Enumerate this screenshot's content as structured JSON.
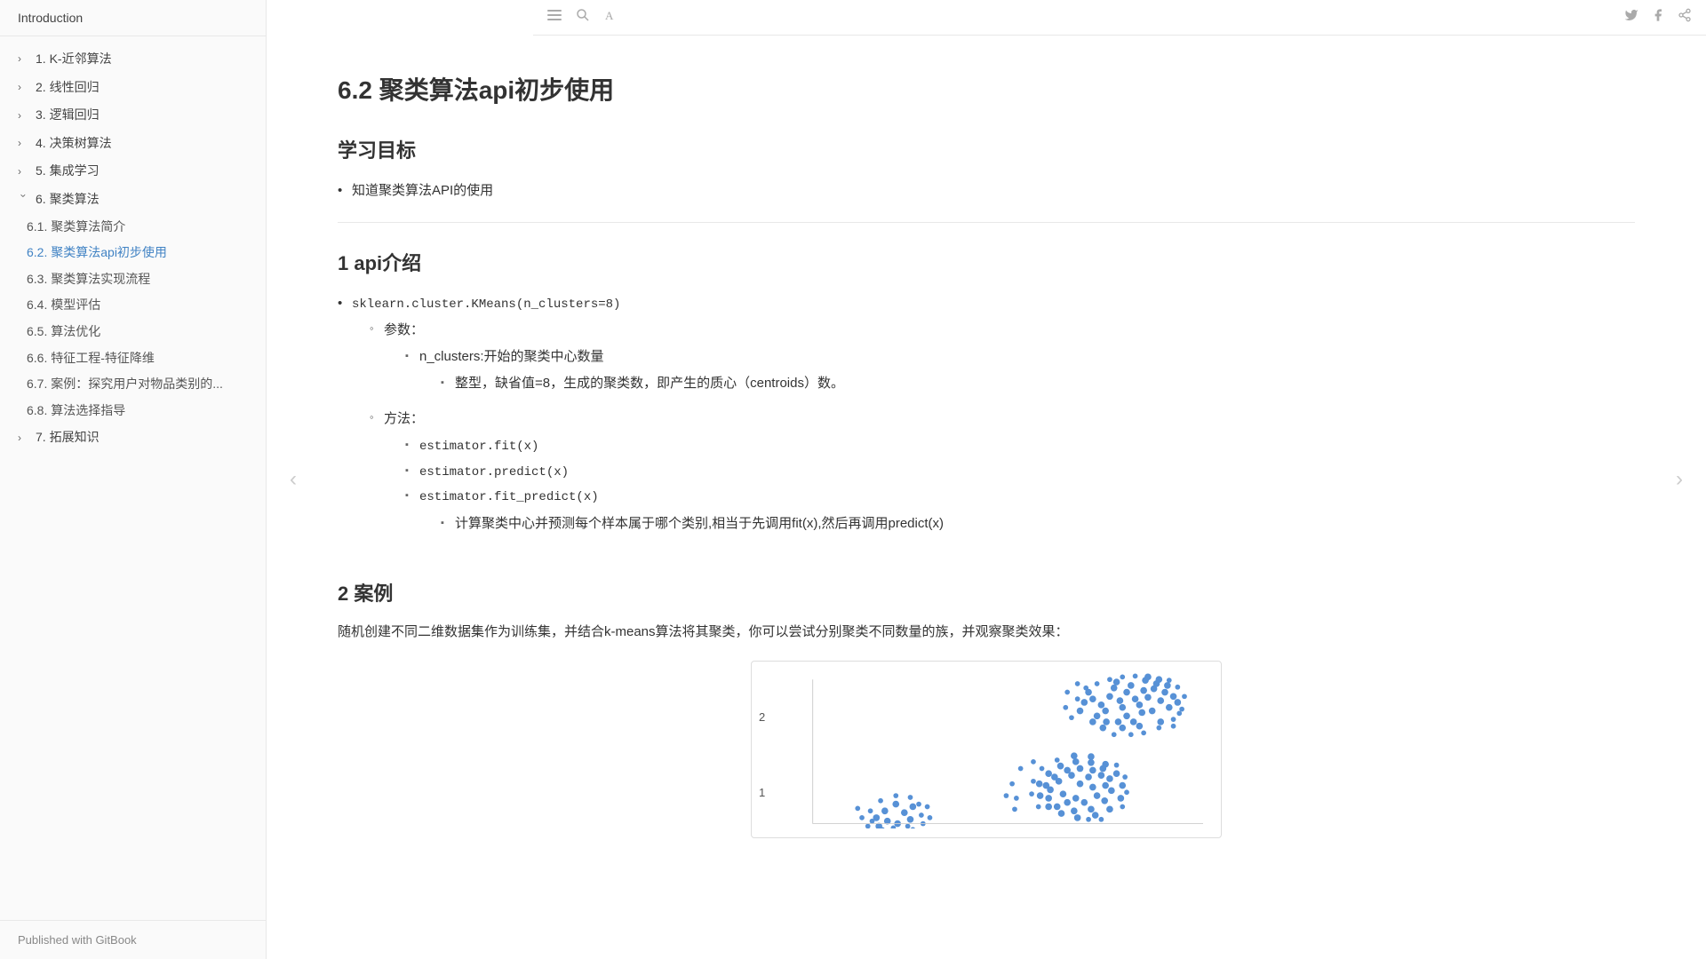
{
  "sidebar": {
    "introduction": "Introduction",
    "items": [
      {
        "id": "knn",
        "label": "1. K-近邻算法",
        "expanded": false,
        "indent": 0
      },
      {
        "id": "linear",
        "label": "2. 线性回归",
        "expanded": false,
        "indent": 0
      },
      {
        "id": "logic",
        "label": "3. 逻辑回归",
        "expanded": false,
        "indent": 0
      },
      {
        "id": "tree",
        "label": "4. 决策树算法",
        "expanded": false,
        "indent": 0
      },
      {
        "id": "ensemble",
        "label": "5. 集成学习",
        "expanded": false,
        "indent": 0
      },
      {
        "id": "clustering",
        "label": "6. 聚类算法",
        "expanded": true,
        "indent": 0
      },
      {
        "id": "c6-1",
        "label": "6.1. 聚类算法简介",
        "expanded": false,
        "indent": 1,
        "sub": true
      },
      {
        "id": "c6-2",
        "label": "6.2. 聚类算法api初步使用",
        "expanded": false,
        "indent": 1,
        "sub": true,
        "active": true
      },
      {
        "id": "c6-3",
        "label": "6.3. 聚类算法实现流程",
        "expanded": false,
        "indent": 1,
        "sub": true
      },
      {
        "id": "c6-4",
        "label": "6.4. 模型评估",
        "expanded": false,
        "indent": 1,
        "sub": true
      },
      {
        "id": "c6-5",
        "label": "6.5. 算法优化",
        "expanded": false,
        "indent": 1,
        "sub": true
      },
      {
        "id": "c6-6",
        "label": "6.6. 特征工程-特征降维",
        "expanded": false,
        "indent": 1,
        "sub": true
      },
      {
        "id": "c6-7",
        "label": "6.7. 案例：探究用户对物品类别的...",
        "expanded": false,
        "indent": 1,
        "sub": true
      },
      {
        "id": "c6-8",
        "label": "6.8. 算法选择指导",
        "expanded": false,
        "indent": 1,
        "sub": true
      },
      {
        "id": "extension",
        "label": "7. 拓展知识",
        "expanded": false,
        "indent": 0
      }
    ],
    "footer": "Published with GitBook"
  },
  "toolbar": {
    "icons": [
      "menu",
      "search",
      "font"
    ]
  },
  "toolbar_right": {
    "icons": [
      "twitter",
      "facebook",
      "share"
    ]
  },
  "content": {
    "page_title": "6.2 聚类算法api初步使用",
    "section1_title": "学习目标",
    "learning_goals": [
      "知道聚类算法API的使用"
    ],
    "section2_title": "1 api介绍",
    "api_main": "sklearn.cluster.KMeans(n_clusters=8)",
    "param_label": "参数：",
    "param_n_clusters": "n_clusters:开始的聚类中心数量",
    "param_n_clusters_detail": "整型，缺省值=8，生成的聚类数，即产生的质心（centroids）数。",
    "method_label": "方法：",
    "method1": "estimator.fit(x)",
    "method2": "estimator.predict(x)",
    "method3": "estimator.fit_predict(x)",
    "method3_detail": "计算聚类中心并预测每个样本属于哪个类别,相当于先调用fit(x),然后再调用predict(x)",
    "section3_title": "2 案例",
    "case_desc": "随机创建不同二维数据集作为训练集，并结合k-means算法将其聚类，你可以尝试分别聚类不同数量的族，并观察聚类效果："
  }
}
